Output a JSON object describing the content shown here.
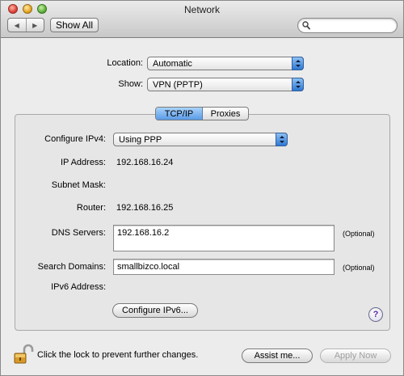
{
  "window": {
    "title": "Network"
  },
  "toolbar": {
    "back_glyph": "◀",
    "forward_glyph": "▶",
    "show_all_label": "Show All",
    "search_value": "",
    "search_placeholder": ""
  },
  "location": {
    "label": "Location:",
    "value": "Automatic"
  },
  "show": {
    "label": "Show:",
    "value": "VPN (PPTP)"
  },
  "tabs": [
    {
      "label": "TCP/IP",
      "selected": true
    },
    {
      "label": "Proxies",
      "selected": false
    }
  ],
  "tcpip": {
    "configure_label": "Configure IPv4:",
    "configure_value": "Using PPP",
    "ip_label": "IP Address:",
    "ip_value": "192.168.16.24",
    "subnet_label": "Subnet Mask:",
    "subnet_value": "",
    "router_label": "Router:",
    "router_value": "192.168.16.25",
    "dns_label": "DNS Servers:",
    "dns_value": "192.168.16.2",
    "dns_optional": "(Optional)",
    "search_label": "Search Domains:",
    "search_value": "smallbizco.local",
    "search_optional": "(Optional)",
    "ipv6_label": "IPv6 Address:",
    "ipv6_value": "",
    "configure_ipv6_label": "Configure IPv6...",
    "help_glyph": "?"
  },
  "footer": {
    "lock_text": "Click the lock to prevent further changes.",
    "assist_label": "Assist me...",
    "apply_label": "Apply Now"
  },
  "colors": {
    "window_bg": "#ececec",
    "panel_bg": "#e6e6e6",
    "selected_tab": "#5a9ae6",
    "popup_arrow": "#2e78d2",
    "disabled_text": "#a0a0a0"
  },
  "icons": [
    "back-arrow-icon",
    "forward-arrow-icon",
    "search-icon",
    "popup-arrows-icon",
    "help-icon",
    "lock-icon"
  ]
}
